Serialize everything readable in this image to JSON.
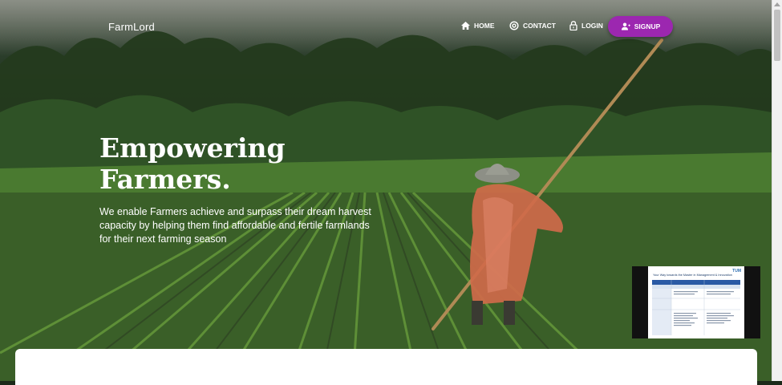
{
  "navbar": {
    "brand": "FarmLord",
    "home_label": "HOME",
    "contact_label": "CONTACT",
    "login_label": "LOGIN",
    "signup_label": "SIGNUP",
    "icons": {
      "home": "home-icon",
      "contact": "at-sign-icon",
      "login": "lock-icon",
      "signup": "person-add-icon"
    }
  },
  "hero": {
    "headline_line1": "Empowering",
    "headline_line2": "Farmers.",
    "tagline": "We enable Farmers achieve and surpass their dream harvest capacity by helping them find affordable and fertile farmlands for their next farming season"
  },
  "video_overlay": {
    "slide_title": "Your Way towards the Master in Management & Innovation",
    "logo": "TUM"
  },
  "colors": {
    "accent": "#9c27b0",
    "text": "#ffffff",
    "card": "#ffffff"
  }
}
